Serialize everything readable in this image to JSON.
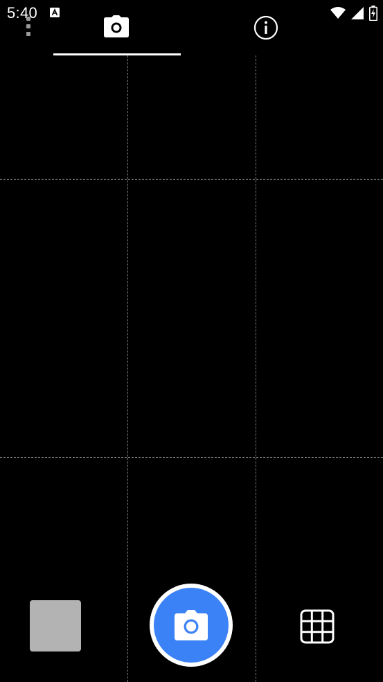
{
  "status_bar": {
    "time": "5:40",
    "icons": [
      "a-notification-icon",
      "wifi-icon",
      "signal-icon",
      "battery-charging-icon"
    ]
  },
  "top_bar": {
    "menu_icon": "overflow-menu-icon",
    "tabs": [
      {
        "icon": "camera-icon",
        "selected": true
      },
      {
        "icon": "info-icon",
        "selected": false
      }
    ]
  },
  "viewfinder": {
    "grid_lines": "3x3 dashed"
  },
  "bottom_bar": {
    "thumbnail": "last-photo-thumbnail",
    "shutter_icon": "camera-icon",
    "grid_icon": "grid-icon"
  },
  "colors": {
    "background": "#000000",
    "shutter_accent": "#3b82f6",
    "thumbnail": "#b3b3b3"
  }
}
